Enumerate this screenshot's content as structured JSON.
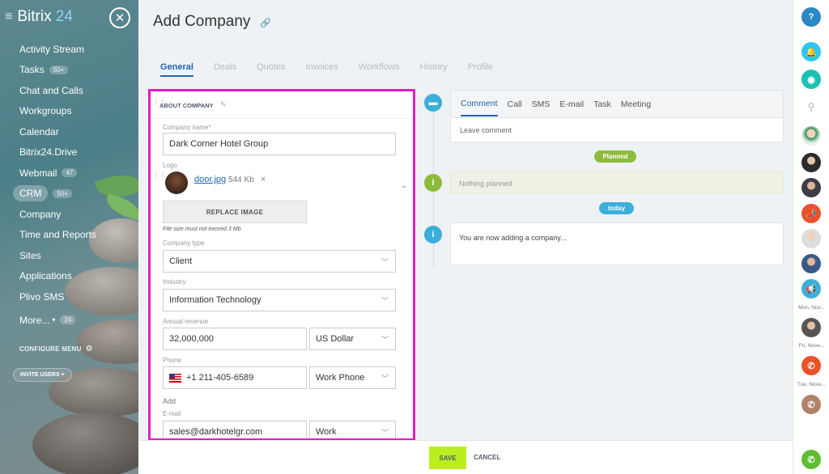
{
  "app": {
    "brand_name": "Bitrix",
    "brand_num": "24"
  },
  "sidebar": {
    "items": [
      {
        "label": "Activity Stream"
      },
      {
        "label": "Tasks",
        "badge": "50+"
      },
      {
        "label": "Chat and Calls"
      },
      {
        "label": "Workgroups"
      },
      {
        "label": "Calendar"
      },
      {
        "label": "Bitrix24.Drive"
      },
      {
        "label": "Webmail",
        "badge": "47"
      },
      {
        "label": "CRM",
        "badge": "50+"
      },
      {
        "label": "Company"
      },
      {
        "label": "Time and Reports"
      },
      {
        "label": "Sites"
      },
      {
        "label": "Applications"
      },
      {
        "label": "Plivo SMS"
      },
      {
        "label": "More...",
        "badge": "24"
      }
    ],
    "configure_menu": "CONFIGURE MENU",
    "invite_users": "INVITE USERS"
  },
  "page": {
    "title": "Add Company",
    "tabs": [
      "General",
      "Deals",
      "Quotes",
      "Invoices",
      "Workflows",
      "History",
      "Profile"
    ]
  },
  "form": {
    "section_title": "ABOUT COMPANY",
    "company_name_label": "Company name*",
    "company_name_value": "Dark Corner Hotel Group",
    "logo_label": "Logo",
    "logo_file": "door.jpg",
    "logo_size": "544 Kb",
    "replace_image": "REPLACE IMAGE",
    "file_hint": "File size must not exceed 3 Mb.",
    "company_type_label": "Company type",
    "company_type_value": "Client",
    "industry_label": "Industry",
    "industry_value": "Information Technology",
    "revenue_label": "Annual revenue",
    "revenue_value": "32,000,000",
    "currency_value": "US Dollar",
    "phone_label": "Phone",
    "phone_value": "+1 211-405-6589",
    "phone_type": "Work Phone",
    "add_label": "Add",
    "email_label": "E-mail",
    "email_value": "sales@darkhotelgr.com",
    "email_type": "Work"
  },
  "timeline": {
    "tabs": [
      "Comment",
      "Call",
      "SMS",
      "E-mail",
      "Task",
      "Meeting"
    ],
    "comment_placeholder": "Leave comment",
    "planned_label": "Planned",
    "nothing_planned": "Nothing planned",
    "today_label": "today",
    "note": "You are now adding a company..."
  },
  "footer": {
    "save": "SAVE",
    "cancel": "CANCEL"
  },
  "rail": {
    "help": "?",
    "labels": [
      "Mon, Nov...",
      "Fri, Nove...",
      "Tue, Nove..."
    ]
  },
  "colors": {
    "accent": "#2067b0",
    "save": "#bbed21",
    "highlight_border": "#e21ec2",
    "planned": "#8dbb3b",
    "today": "#3bafda"
  }
}
